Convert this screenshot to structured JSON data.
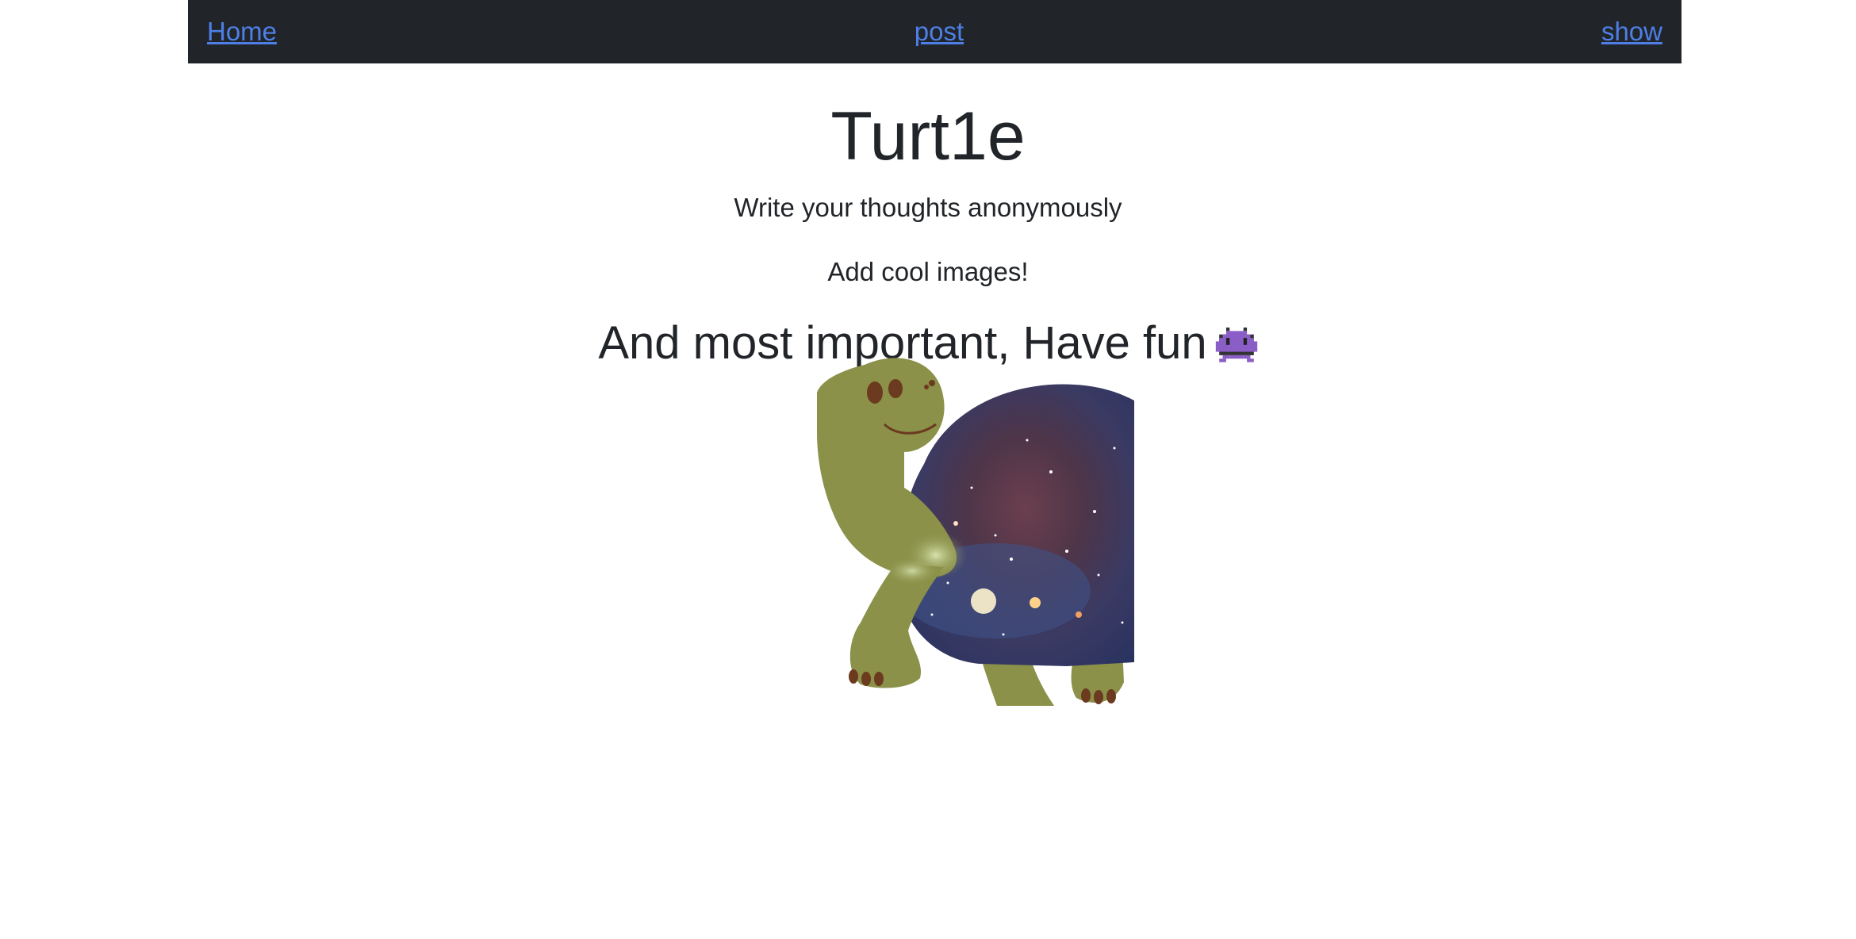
{
  "nav": {
    "home_label": "Home",
    "post_label": "post",
    "show_label": "show",
    "link_color": "#4d7fe6",
    "background": "#212529"
  },
  "hero": {
    "title": "Turt1e",
    "line1": "Write your thoughts anonymously",
    "line2": "Add cool images!",
    "headline": "And most important, Have fun",
    "headline_icon": "alien-monster-icon"
  },
  "image": {
    "icon": "galaxy-turtle-image",
    "shell_theme": "galaxy"
  }
}
